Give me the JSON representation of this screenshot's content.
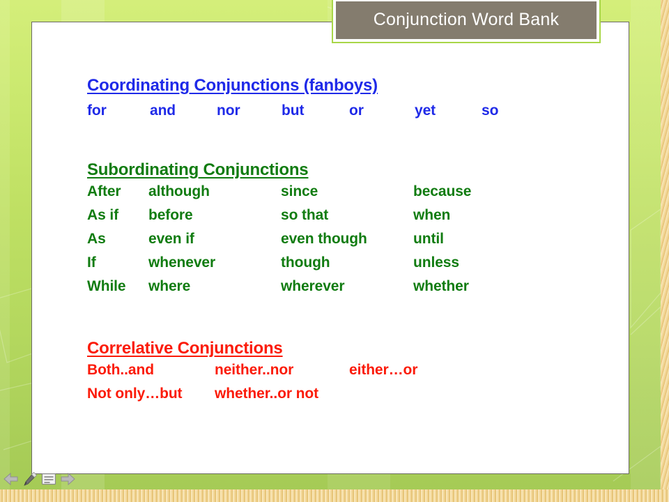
{
  "slide": {
    "title": "Conjunction Word Bank",
    "colors": {
      "background_green_top": "#d4ee7a",
      "background_green_bottom": "#a4ca55",
      "title_box_fill": "#847c6e",
      "title_box_border": "#a8d648",
      "panel_background": "#ffffff",
      "panel_border": "#6b6b63",
      "accent_gold": "#f3d89a",
      "blue_text": "#1f2ae8",
      "green_text": "#117c11",
      "red_text": "#fb1b09"
    }
  },
  "sections": [
    {
      "id": "coordinating",
      "heading": "Coordinating Conjunctions (fanboys)",
      "color": "blue",
      "rows": [
        [
          "for",
          "and",
          "nor",
          "but",
          "or",
          "yet",
          "so"
        ]
      ]
    },
    {
      "id": "subordinating",
      "heading": "Subordinating Conjunctions",
      "color": "green",
      "rows": [
        [
          "After",
          "although",
          "since",
          "because"
        ],
        [
          "As if",
          "before",
          "so that",
          "when"
        ],
        [
          "As",
          "even if",
          "even though",
          "until"
        ],
        [
          "If",
          "whenever",
          "though",
          "unless"
        ],
        [
          "While",
          "where",
          "wherever",
          "whether"
        ]
      ]
    },
    {
      "id": "correlative",
      "heading": "Correlative Conjunctions",
      "color": "red",
      "rows": [
        [
          "Both..and",
          "neither..nor",
          "either…or"
        ],
        [
          "Not only…but",
          "whether..or not"
        ]
      ]
    }
  ],
  "controls": [
    {
      "name": "previous-slide",
      "label": "Previous"
    },
    {
      "name": "pen-tool",
      "label": "Pen"
    },
    {
      "name": "slide-menu",
      "label": "Menu"
    },
    {
      "name": "next-slide",
      "label": "Next"
    }
  ]
}
